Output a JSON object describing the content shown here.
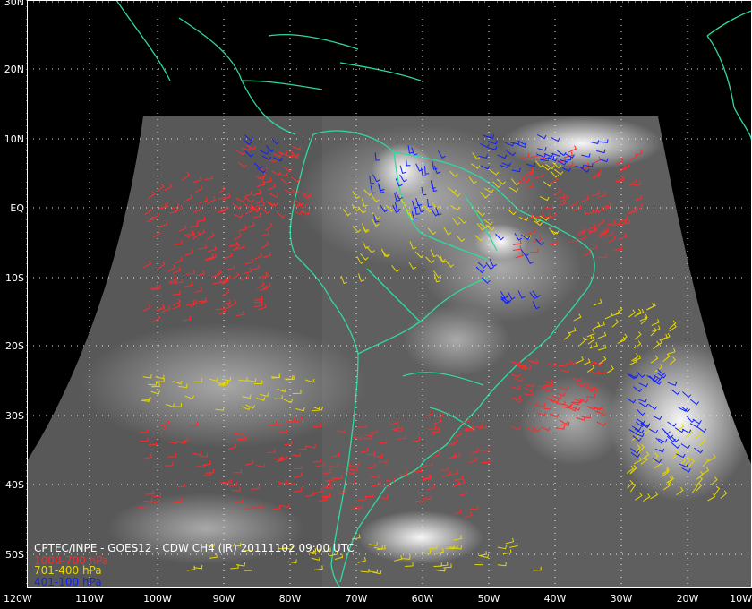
{
  "product_title": "CPTEC/INPE - GOES12 - CDW CH4 (IR) 20111102 09:00 UTC",
  "legend": [
    {
      "label": "1000-700 hPa",
      "color": "#ff2a2a"
    },
    {
      "label": "701-400 hPa",
      "color": "#e6d800"
    },
    {
      "label": "401-100 hPa",
      "color": "#1020ff"
    }
  ],
  "lat_labels": [
    "30N",
    "20N",
    "10N",
    "EQ",
    "10S",
    "20S",
    "30S",
    "40S",
    "50S"
  ],
  "lon_labels": [
    "120W",
    "110W",
    "100W",
    "90W",
    "80W",
    "70W",
    "60W",
    "50W",
    "40W",
    "30W",
    "20W",
    "10W"
  ],
  "colors": {
    "background": "#000000",
    "coastline": "#2fd9a0",
    "grid": "#ffffff",
    "satellite": "#6e6e6e"
  }
}
